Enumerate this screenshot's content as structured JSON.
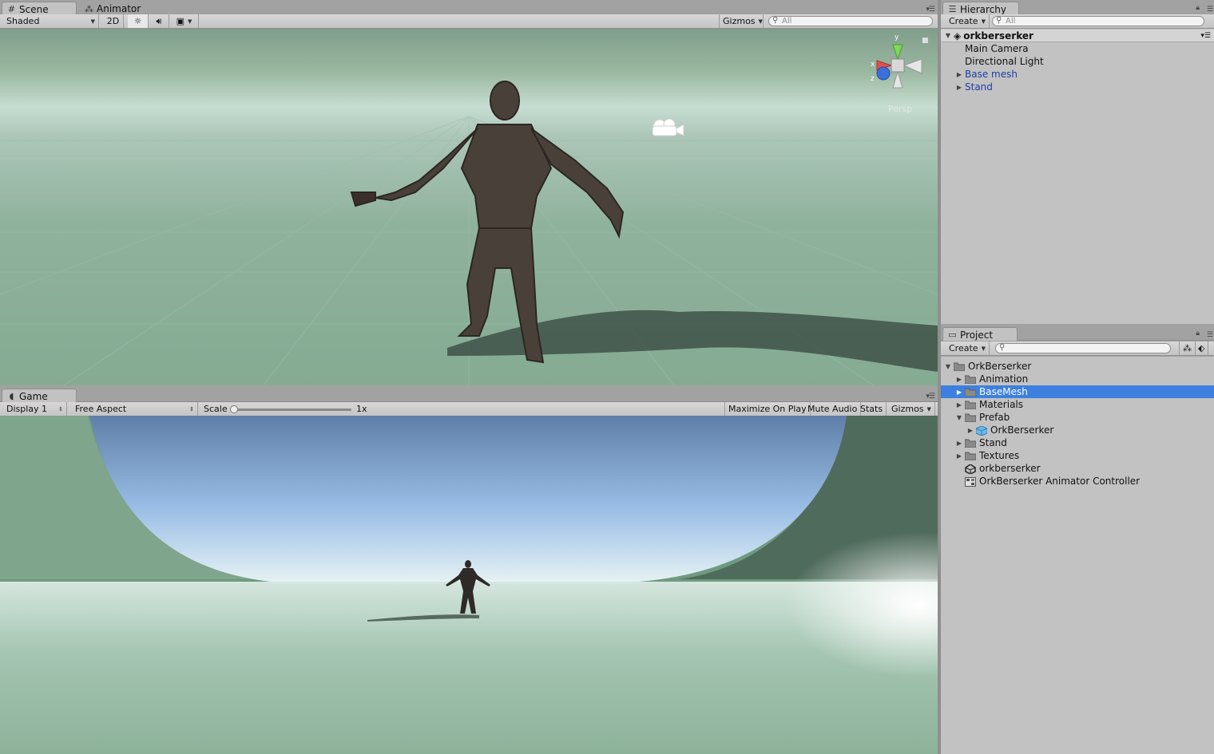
{
  "scene_panel": {
    "tabs": [
      {
        "label": "Scene",
        "icon": "grid-icon",
        "active": true
      },
      {
        "label": "Animator",
        "icon": "animator-icon",
        "active": false
      }
    ],
    "toolbar": {
      "shading_mode": "Shaded",
      "mode_2d": "2D",
      "lighting_toggle": "sun-icon",
      "audio_toggle": "speaker-icon",
      "effects_toggle": "image-icon",
      "gizmos_label": "Gizmos",
      "search_placeholder": "All"
    },
    "gizmo": {
      "y_label": "y",
      "x_label": "x",
      "z_label": "z",
      "projection": "Persp"
    }
  },
  "game_panel": {
    "tab": {
      "label": "Game",
      "icon": "pacman-icon"
    },
    "toolbar": {
      "display": "Display 1",
      "aspect": "Free Aspect",
      "scale_label": "Scale",
      "scale_value": "1x",
      "scale_level": 0.0,
      "maximize_on_play": "Maximize On Play",
      "mute_audio": "Mute Audio",
      "stats": "Stats",
      "gizmos_label": "Gizmos"
    }
  },
  "hierarchy": {
    "tab_label": "Hierarchy",
    "create_label": "Create",
    "search_placeholder": "All",
    "scene_name": "orkberserker",
    "items": [
      {
        "label": "Main Camera",
        "expandable": false,
        "prefab": false
      },
      {
        "label": "Directional Light",
        "expandable": false,
        "prefab": false
      },
      {
        "label": "Base mesh",
        "expandable": true,
        "prefab": true
      },
      {
        "label": "Stand",
        "expandable": true,
        "prefab": true
      }
    ]
  },
  "project": {
    "tab_label": "Project",
    "create_label": "Create",
    "search_placeholder": "",
    "items": [
      {
        "label": "OrkBerserker",
        "icon": "folder-icon",
        "depth": 0,
        "arrow": "down"
      },
      {
        "label": "Animation",
        "icon": "folder-icon",
        "depth": 1,
        "arrow": "right"
      },
      {
        "label": "BaseMesh",
        "icon": "folder-icon",
        "depth": 1,
        "arrow": "right",
        "selected": true
      },
      {
        "label": "Materials",
        "icon": "folder-icon",
        "depth": 1,
        "arrow": "right"
      },
      {
        "label": "Prefab",
        "icon": "folder-icon",
        "depth": 1,
        "arrow": "down"
      },
      {
        "label": "OrkBerserker",
        "icon": "prefab-cube-icon",
        "depth": 2,
        "arrow": "right"
      },
      {
        "label": "Stand",
        "icon": "folder-icon",
        "depth": 1,
        "arrow": "right"
      },
      {
        "label": "Textures",
        "icon": "folder-icon",
        "depth": 1,
        "arrow": "right"
      },
      {
        "label": "orkberserker",
        "icon": "unity-scene-icon",
        "depth": 1,
        "arrow": "none"
      },
      {
        "label": "OrkBerserker Animator Controller",
        "icon": "animator-controller-icon",
        "depth": 1,
        "arrow": "none"
      }
    ]
  },
  "colors": {
    "selection": "#3d80df",
    "prefab_text": "#1a3fa6",
    "panel_bg": "#c2c2c2"
  }
}
